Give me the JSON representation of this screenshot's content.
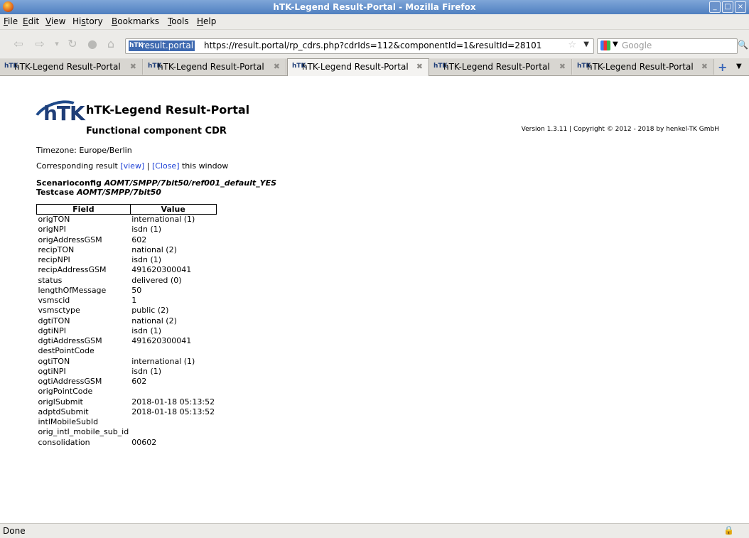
{
  "window": {
    "title": "hTK-Legend Result-Portal - Mozilla Firefox",
    "controls": [
      "_",
      "□",
      "×"
    ]
  },
  "menu": [
    {
      "pre": "",
      "key": "F",
      "post": "ile"
    },
    {
      "pre": "",
      "key": "E",
      "post": "dit"
    },
    {
      "pre": "",
      "key": "V",
      "post": "iew"
    },
    {
      "pre": "Hi",
      "key": "s",
      "post": "tory"
    },
    {
      "pre": "",
      "key": "B",
      "post": "ookmarks"
    },
    {
      "pre": "",
      "key": "T",
      "post": "ools"
    },
    {
      "pre": "",
      "key": "H",
      "post": "elp"
    }
  ],
  "nav": {
    "identity": "result.portal",
    "url": "https://result.portal/rp_cdrs.php?cdrIds=112&componentId=1&resultId=28101",
    "search_placeholder": "Google"
  },
  "tabs": [
    {
      "label": "hTK-Legend Result-Portal",
      "active": false
    },
    {
      "label": "hTK-Legend Result-Portal",
      "active": false
    },
    {
      "label": "hTK-Legend Result-Portal",
      "active": true
    },
    {
      "label": "hTK-Legend Result-Portal",
      "active": false
    },
    {
      "label": "hTK-Legend Result-Portal",
      "active": false
    }
  ],
  "page": {
    "logo_text": "hTK",
    "title": "hTK-Legend Result-Portal",
    "subtitle": "Functional component CDR",
    "version": "Version 1.3.11 | Copyright © 2012 - 2018 by henkel-TK GmbH",
    "timezone": "Timezone: Europe/Berlin",
    "corresponding_prefix": "Corresponding result ",
    "view_link": "[view]",
    "separator": " | ",
    "close_link": "[Close]",
    "corresponding_suffix": " this window",
    "scenario_label": "Scenarioconfig ",
    "scenario_value": "AOMT/SMPP/7bit50/ref001_default_YES",
    "testcase_label": "Testcase ",
    "testcase_value": "AOMT/SMPP/7bit50"
  },
  "table": {
    "headers": [
      "Field",
      "Value"
    ],
    "rows": [
      [
        "origTON",
        "international (1)"
      ],
      [
        "origNPI",
        "isdn (1)"
      ],
      [
        "origAddressGSM",
        "602"
      ],
      [
        "recipTON",
        "national (2)"
      ],
      [
        "recipNPI",
        "isdn (1)"
      ],
      [
        "recipAddressGSM",
        "491620300041"
      ],
      [
        "status",
        "delivered (0)"
      ],
      [
        "lengthOfMessage",
        "50"
      ],
      [
        "vsmscid",
        "1"
      ],
      [
        "vsmsctype",
        "public (2)"
      ],
      [
        "dgtiTON",
        "national (2)"
      ],
      [
        "dgtiNPI",
        "isdn (1)"
      ],
      [
        "dgtiAddressGSM",
        "491620300041"
      ],
      [
        "destPointCode",
        ""
      ],
      [
        "ogtiTON",
        "international (1)"
      ],
      [
        "ogtiNPI",
        "isdn (1)"
      ],
      [
        "ogtiAddressGSM",
        "602"
      ],
      [
        "origPointCode",
        ""
      ],
      [
        "origlSubmit",
        "2018-01-18 05:13:52"
      ],
      [
        "adptdSubmit",
        "2018-01-18 05:13:52"
      ],
      [
        "intlMobileSubId",
        ""
      ],
      [
        "orig_intl_mobile_sub_id",
        ""
      ],
      [
        "consolidation",
        "00602"
      ]
    ]
  },
  "status": {
    "text": "Done"
  }
}
